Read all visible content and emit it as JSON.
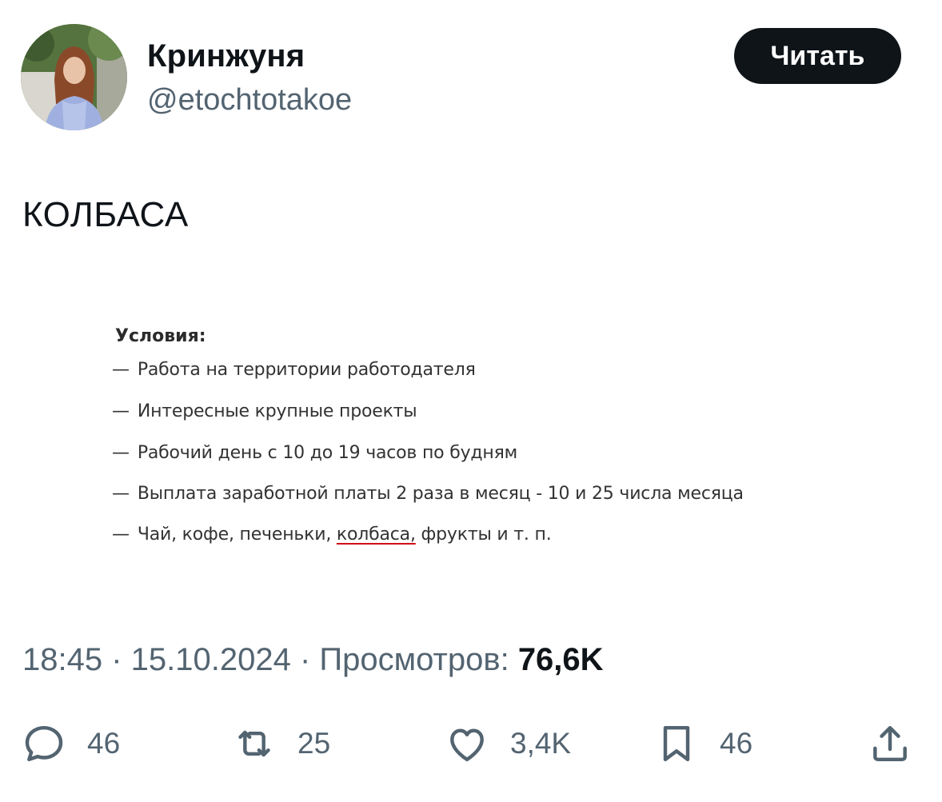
{
  "user": {
    "display_name": "Кринжуня",
    "handle": "@etochtotakoe"
  },
  "follow_button": {
    "label": "Читать"
  },
  "tweet": {
    "text": "КОЛБАСА"
  },
  "embedded_image": {
    "title": "Условия:",
    "conditions": [
      "Работа на территории работодателя",
      "Интересные крупные проекты",
      "Рабочий день с 10 до 19 часов по будням",
      "Выплата заработной платы 2 раза в месяц - 10 и 25 числа месяца"
    ],
    "last_condition": {
      "before": "Чай, кофе, печеньки, ",
      "highlight": "колбаса,",
      "after": " фрукты и т. п."
    },
    "dash": "—",
    "highlight_color": "#d0021b"
  },
  "meta": {
    "time": "18:45",
    "separator": " · ",
    "date": "15.10.2024",
    "views_label": "Просмотров: ",
    "views_count": "76,6K"
  },
  "actions": {
    "reply": {
      "icon": "reply-icon",
      "count": "46"
    },
    "retweet": {
      "icon": "retweet-icon",
      "count": "25"
    },
    "like": {
      "icon": "heart-icon",
      "count": "3,4K"
    },
    "bookmark": {
      "icon": "bookmark-icon",
      "count": "46"
    },
    "share": {
      "icon": "share-icon"
    }
  },
  "colors": {
    "text": "#0f1419",
    "secondary": "#536471",
    "button_bg": "#0f1419",
    "button_text": "#ffffff"
  }
}
